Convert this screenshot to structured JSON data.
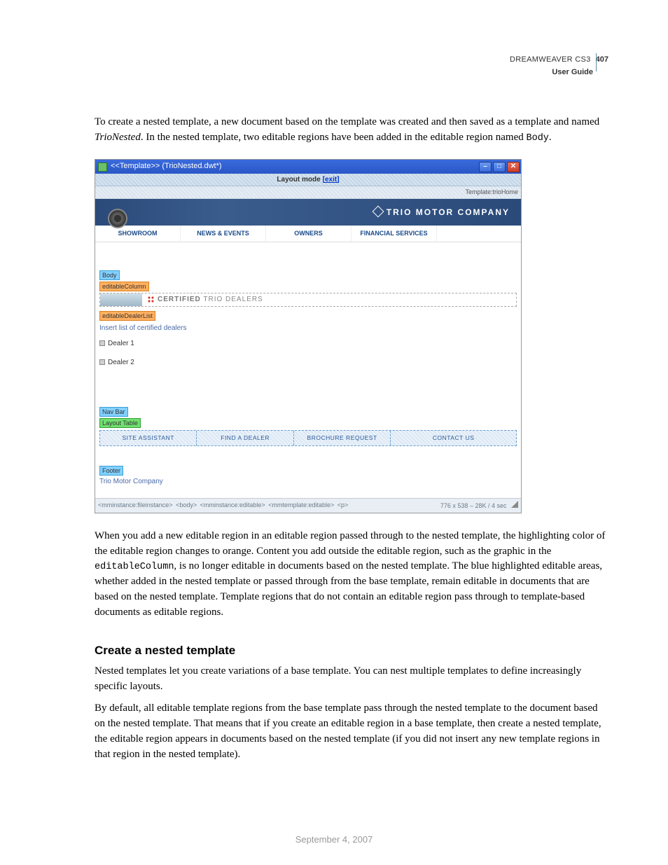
{
  "header": {
    "product": "DREAMWEAVER CS3",
    "page_number": "407",
    "guide": "User Guide"
  },
  "intro": {
    "p1a": "To create a nested template, a new document based on the template was created and then saved as a template and named ",
    "p1b": "TrioNested",
    "p1c": ". In the nested template, two editable regions have been added in the editable region named ",
    "p1d": "Body",
    "p1e": "."
  },
  "screenshot": {
    "title": "<<Template>> (TrioNested.dwt*)",
    "layout_mode": "Layout mode",
    "exit_link": "[exit]",
    "template_indicator": "Template:trioHome",
    "brand": "TRIO MOTOR COMPANY",
    "mainnav": [
      "SHOWROOM",
      "NEWS & EVENTS",
      "OWNERS",
      "FINANCIAL SERVICES"
    ],
    "tags": {
      "body": "Body",
      "editableColumn": "editableColumn",
      "editableDealerList": "editableDealerList",
      "navbar": "Nav Bar",
      "layoutTable": "Layout Table",
      "footer": "Footer"
    },
    "certified_a": "CERTIFIED",
    "certified_b": " TRIO DEALERS",
    "dealer_intro": "Insert list of certified dealers",
    "dealers": [
      "Dealer 1",
      "Dealer 2"
    ],
    "bottomnav": [
      "SITE ASSISTANT",
      "FIND A DEALER",
      "BROCHURE REQUEST",
      "CONTACT US"
    ],
    "footer_text": "Trio Motor Company",
    "status_tags": [
      "<mminstance:fileinstance>",
      "<body>",
      "<mminstance:editable>",
      "<mmtemplate:editable>",
      "<p>"
    ],
    "status_info": "776 x 538 – 28K / 4 sec"
  },
  "after": {
    "p1a": "When you add a new editable region in an editable region passed through to the nested template, the highlighting color of the editable region changes to orange. Content you add outside the editable region, such as the graphic in the ",
    "p1b": "editableColumn",
    "p1c": ", is no longer editable in documents based on the nested template. The blue highlighted editable areas, whether added in the nested template or passed through from the base template, remain editable in documents that are based on the nested template. Template regions that do not contain an editable region pass through to template-based documents as editable regions."
  },
  "section": {
    "heading": "Create a nested template",
    "p1": "Nested templates let you create variations of a base template. You can nest multiple templates to define increasingly specific layouts.",
    "p2": "By default, all editable template regions from the base template pass through the nested template to the document based on the nested template. That means that if you create an editable region in a base template, then create a nested template, the editable region appears in documents based on the nested template (if you did not insert any new template regions in that region in the nested template)."
  },
  "footer_date": "September 4, 2007"
}
